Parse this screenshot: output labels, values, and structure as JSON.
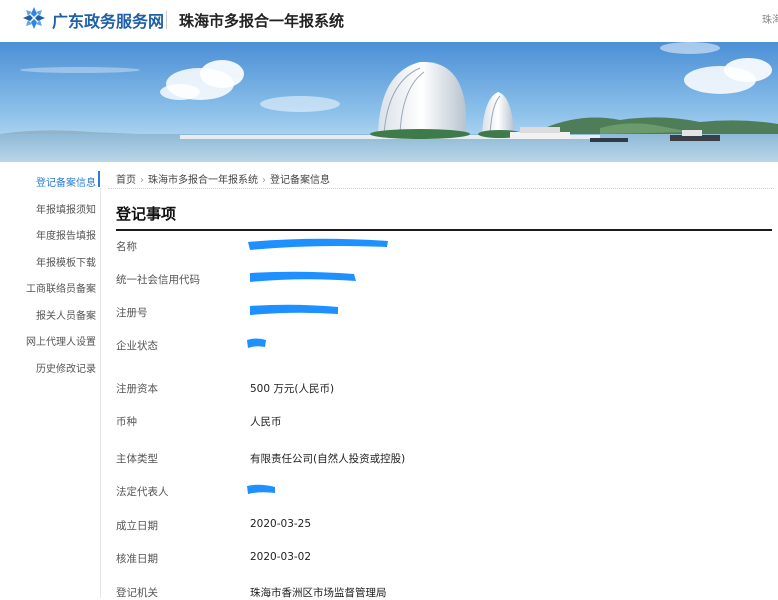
{
  "header": {
    "portal_name": "广东政务服务网",
    "system_title": "珠海市多报合一年报系统",
    "right_text": "珠海"
  },
  "sidebar": {
    "items": [
      {
        "label": "登记备案信息",
        "active": true
      },
      {
        "label": "年报填报须知",
        "active": false
      },
      {
        "label": "年度报告填报",
        "active": false
      },
      {
        "label": "年报模板下载",
        "active": false
      },
      {
        "label": "工商联络员备案",
        "active": false
      },
      {
        "label": "报关人员备案",
        "active": false
      },
      {
        "label": "网上代理人设置",
        "active": false
      },
      {
        "label": "历史修改记录",
        "active": false
      }
    ]
  },
  "breadcrumb": {
    "items": [
      "首页",
      "珠海市多报合一年报系统",
      "登记备案信息"
    ]
  },
  "section": {
    "title": "登记事项"
  },
  "fields": [
    {
      "label": "名称",
      "value": ""
    },
    {
      "label": "统一社会信用代码",
      "value": ""
    },
    {
      "label": "注册号",
      "value": ""
    },
    {
      "label": "企业状态",
      "value": ""
    },
    {
      "label": "注册资本",
      "value": "500 万元(人民币)"
    },
    {
      "label": "币种",
      "value": "人民币"
    },
    {
      "label": "主体类型",
      "value": "有限责任公司(自然人投资或控股)"
    },
    {
      "label": "法定代表人",
      "value": ""
    },
    {
      "label": "成立日期",
      "value": "2020-03-25"
    },
    {
      "label": "核准日期",
      "value": "2020-03-02"
    },
    {
      "label": "登记机关",
      "value": "珠海市香洲区市场监督管理局"
    }
  ],
  "colors": {
    "accent": "#2b7cd3",
    "brand": "#1f5fa6",
    "redaction": "#1e90ff"
  }
}
